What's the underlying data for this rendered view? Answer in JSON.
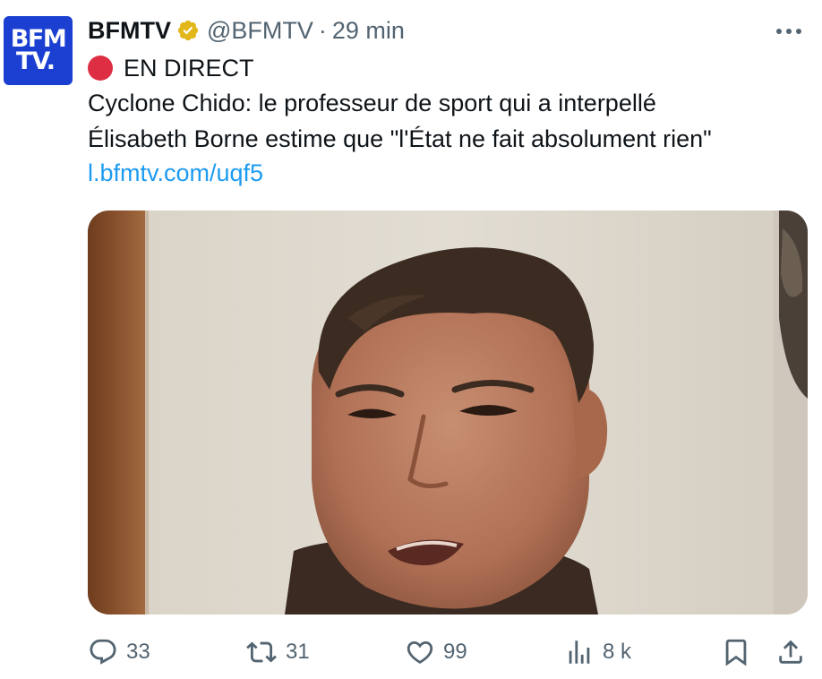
{
  "tweet": {
    "author_name": "BFMTV",
    "handle": "@BFMTV",
    "separator": "·",
    "time": "29 min",
    "avatar_line1": "BFM",
    "avatar_line2": "TV.",
    "live_label": "EN DIRECT",
    "text_line1": "Cyclone Chido: le professeur de sport qui a interpellé",
    "text_line2": "Élisabeth Borne estime que \"l'État ne fait absolument rien\"",
    "link": "l.bfmtv.com/uqf5"
  },
  "actions": {
    "replies": "33",
    "retweets": "31",
    "likes": "99",
    "views": "8 k"
  },
  "colors": {
    "text": "#0f1419",
    "secondary": "#536471",
    "link": "#1d9bf0",
    "avatar_bg": "#1a3fd1",
    "verified_gold": "#e2b719",
    "live_red": "#dd2e44"
  },
  "icons": [
    "more-icon",
    "verified-icon",
    "live-dot-icon",
    "reply-icon",
    "retweet-icon",
    "like-icon",
    "views-icon",
    "bookmark-icon",
    "share-icon"
  ]
}
